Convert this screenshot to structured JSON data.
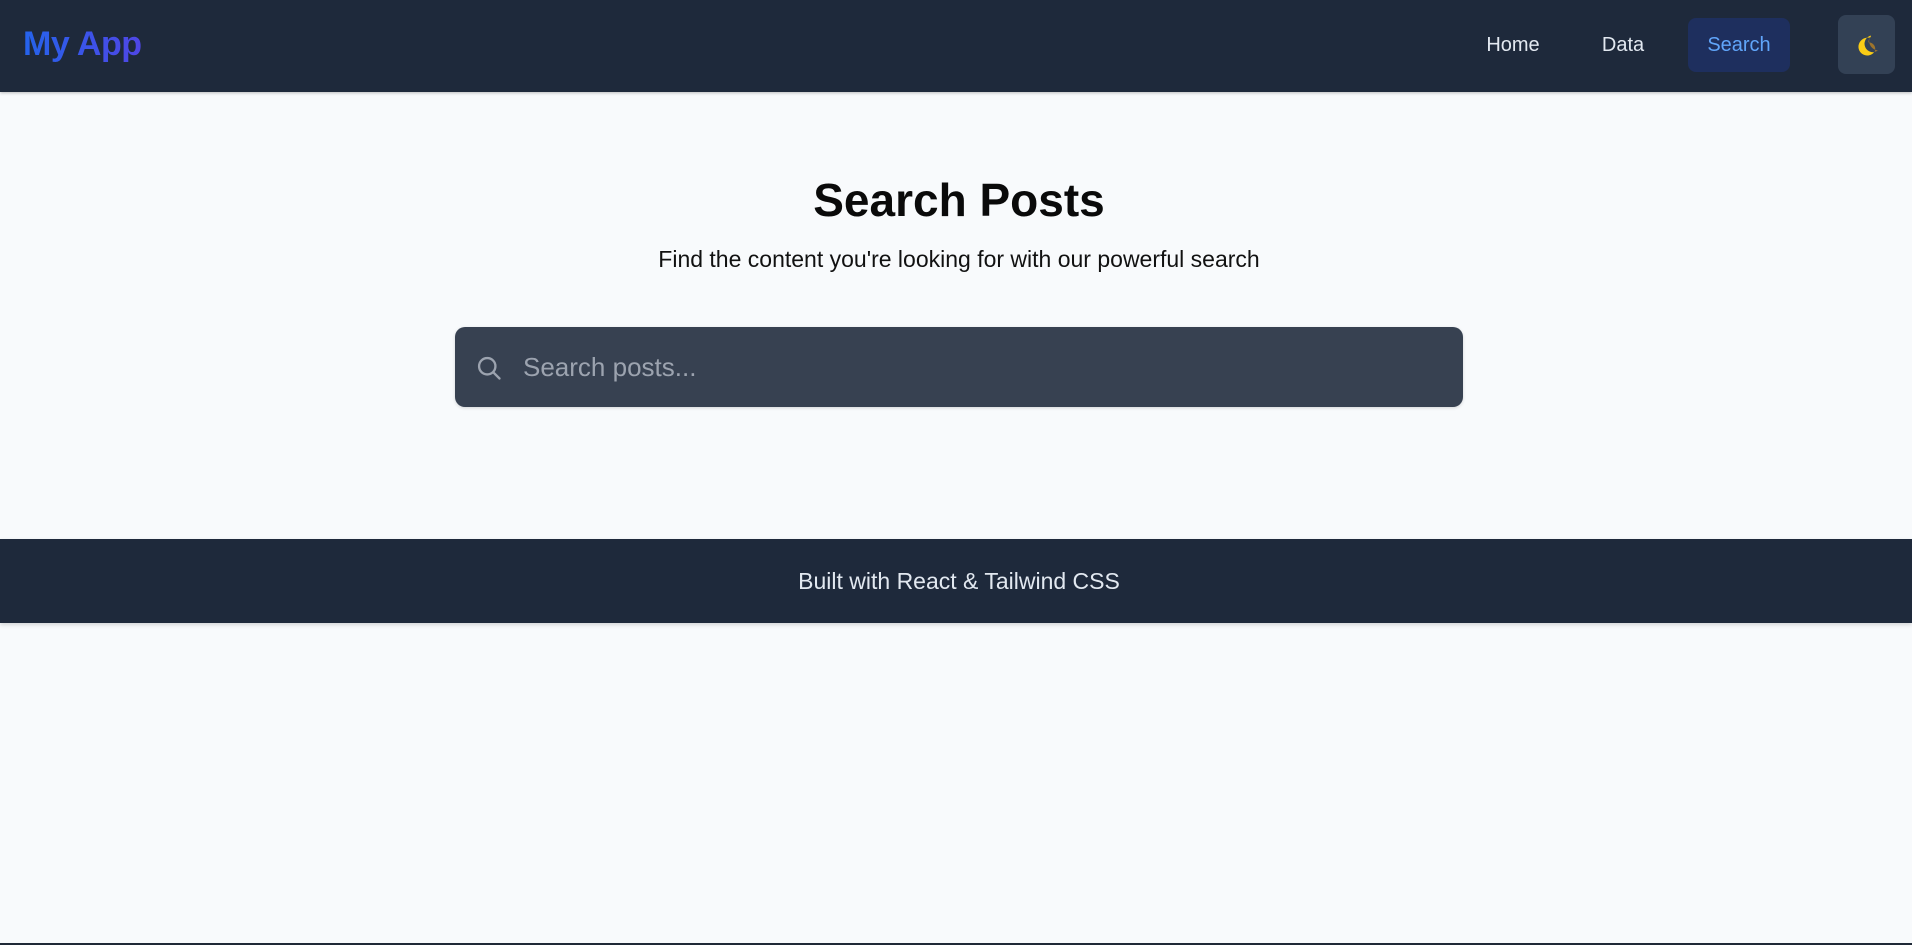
{
  "header": {
    "brand": "My App",
    "nav": {
      "home": "Home",
      "data": "Data",
      "search": "Search"
    },
    "active_nav": "search",
    "theme_toggle_icon": "moon-icon"
  },
  "main": {
    "title": "Search Posts",
    "subtitle": "Find the content you're looking for with our powerful search",
    "search": {
      "placeholder": "Search posts...",
      "value": "",
      "icon": "search-icon"
    }
  },
  "footer": {
    "text": "Built with React & Tailwind CSS"
  },
  "colors": {
    "navbar_bg": "#1e293b",
    "brand_gradient_start": "#2563eb",
    "brand_gradient_end": "#4f46e5",
    "active_nav_bg": "#1e2f5e",
    "active_nav_text": "#60a5fa",
    "search_box_bg": "#374151",
    "page_bg": "#f8fafc",
    "moon": "#facc15"
  }
}
